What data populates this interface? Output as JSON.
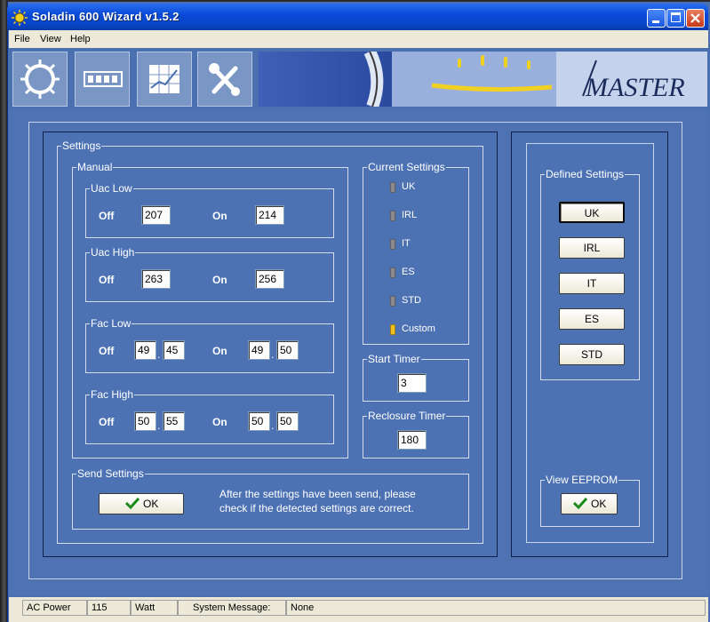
{
  "window": {
    "title": "Soladin 600 Wizard v1.5.2",
    "accent": "#0a4ad8"
  },
  "menu": {
    "items": [
      "File",
      "View",
      "Help"
    ]
  },
  "toolbar": {
    "banner_text": "MASTER",
    "tools": [
      "sun-icon",
      "display-icon",
      "chart-icon",
      "tools-icon"
    ]
  },
  "settings": {
    "legend": "Settings",
    "manual": {
      "legend": "Manual",
      "off_label": "Off",
      "on_label": "On",
      "uac_low": {
        "legend": "Uac Low",
        "off": "207",
        "on": "214"
      },
      "uac_high": {
        "legend": "Uac High",
        "off": "263",
        "on": "256"
      },
      "fac_low": {
        "legend": "Fac Low",
        "off_int": "49",
        "off_dec": "45",
        "on_int": "49",
        "on_dec": "50"
      },
      "fac_high": {
        "legend": "Fac High",
        "off_int": "50",
        "off_dec": "55",
        "on_int": "50",
        "on_dec": "50"
      },
      "decimal_sep": "."
    },
    "current": {
      "legend": "Current Settings",
      "items": [
        {
          "label": "UK",
          "active": false
        },
        {
          "label": "IRL",
          "active": false
        },
        {
          "label": "IT",
          "active": false
        },
        {
          "label": "ES",
          "active": false
        },
        {
          "label": "STD",
          "active": false
        },
        {
          "label": "Custom",
          "active": true
        }
      ]
    },
    "start_timer": {
      "legend": "Start Timer",
      "value": "3"
    },
    "reclosure_timer": {
      "legend": "Reclosure Timer",
      "value": "180"
    },
    "send": {
      "legend": "Send Settings",
      "ok_label": "OK",
      "note_line1": "After the settings have been send, please",
      "note_line2": "check if the detected settings are correct."
    }
  },
  "defined": {
    "legend": "Defined Settings",
    "buttons": [
      "UK",
      "IRL",
      "IT",
      "ES",
      "STD"
    ],
    "selected": "UK"
  },
  "eeprom": {
    "legend": "View EEPROM",
    "ok_label": "OK"
  },
  "status": {
    "ac_power_label": "AC Power",
    "ac_power_value": "115",
    "unit": "Watt",
    "message_label": "System Message:",
    "message_value": "None"
  }
}
